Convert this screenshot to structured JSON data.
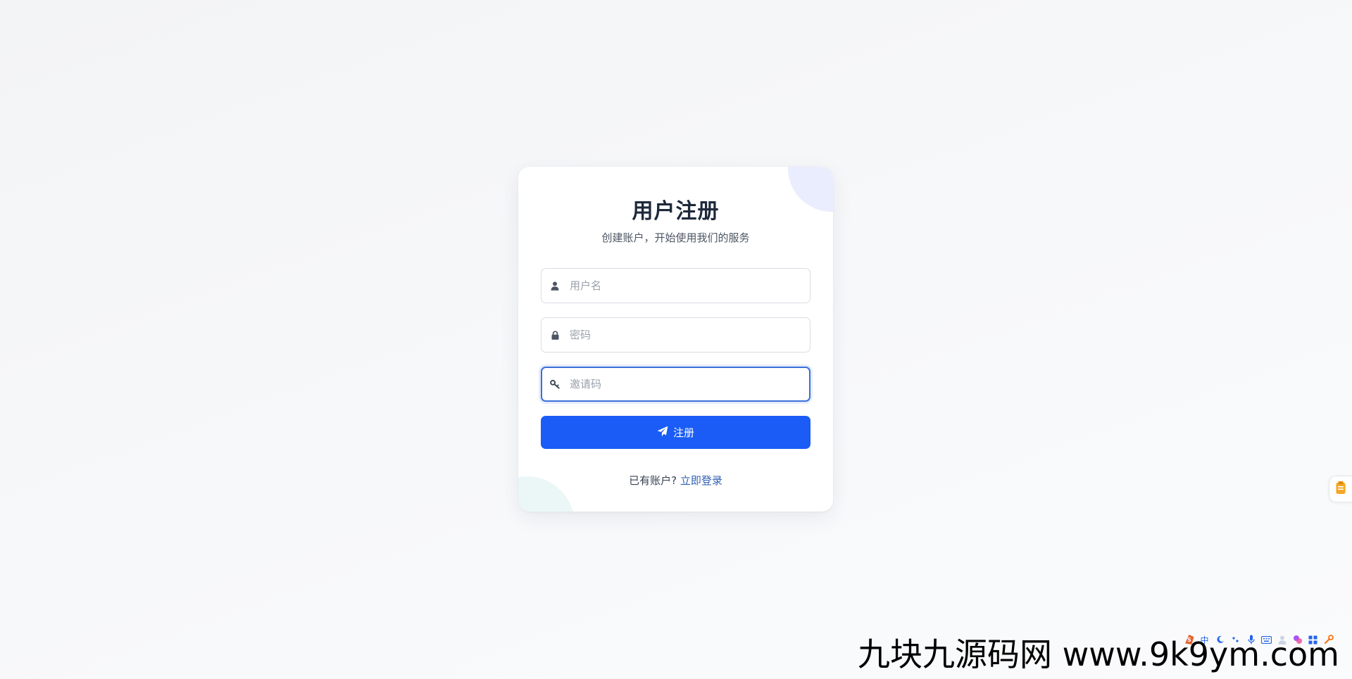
{
  "register_card": {
    "title": "用户注册",
    "subtitle": "创建账户，开始使用我们的服务",
    "username": {
      "placeholder": "用户名",
      "value": "",
      "icon": "user-icon"
    },
    "password": {
      "placeholder": "密码",
      "value": "",
      "icon": "lock-icon"
    },
    "invite_code": {
      "placeholder": "邀请码",
      "value": "",
      "icon": "key-icon"
    },
    "submit": {
      "label": "注册",
      "icon": "paper-plane-icon"
    },
    "login_prompt": "已有账户?",
    "login_link": "立即登录"
  },
  "colors": {
    "primary": "#1a5cf5",
    "link": "#2f5fb3",
    "title": "#1e293b",
    "focus_border": "#3b6fd8",
    "accent_top_right": "#e9edfd",
    "accent_bottom_left": "#ebf7f6"
  },
  "side_widget": {
    "icon": "clipboard-icon"
  },
  "system_tray": {
    "icons": [
      "s-logo-icon",
      "ime-chinese-icon",
      "moon-icon",
      "punctuation-icon",
      "microphone-icon",
      "keyboard-icon",
      "user-icon",
      "skin-icon",
      "grid-icon",
      "tools-icon"
    ],
    "ime_label": "中"
  },
  "watermark": {
    "text": "九块九源码网 www.9k9ym.com"
  }
}
